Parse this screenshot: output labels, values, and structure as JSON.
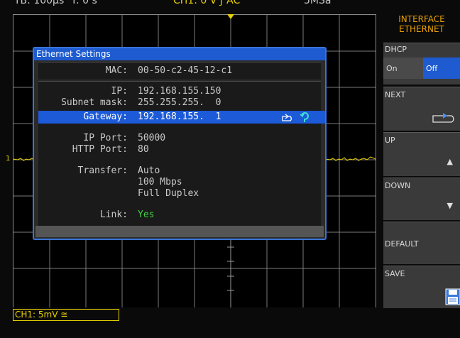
{
  "status_bar": {
    "timebase": "TB: 100µs",
    "offset": "T: 0 s",
    "trigger": "CH1: 0 V ƒ AC",
    "sample_rate": "5MSa"
  },
  "menu": {
    "title_line1": "INTERFACE",
    "title_line2": "ETHERNET",
    "dhcp_label": "DHCP",
    "dhcp_on": "On",
    "dhcp_off": "Off",
    "dhcp_selected": "Off",
    "next_label": "NEXT",
    "up_label": "UP",
    "down_label": "DOWN",
    "default_label": "DEFAULT",
    "save_label": "SAVE"
  },
  "dialog": {
    "title": "Ethernet Settings",
    "mac_label": "MAC:",
    "mac_value": "00-50-c2-45-12-c1",
    "ip_label": "IP:",
    "ip_value": "192.168.155.150",
    "subnet_label": "Subnet mask:",
    "subnet_value": "255.255.255.  0",
    "gateway_label": "Gateway:",
    "gateway_value": "192.168.155.  1",
    "ip_port_label": "IP Port:",
    "ip_port_value": "50000",
    "http_port_label": "HTTP Port:",
    "http_port_value": "80",
    "transfer_label": "Transfer:",
    "transfer_value_1": "Auto",
    "transfer_value_2": "100 Mbps",
    "transfer_value_3": "Full Duplex",
    "link_label": "Link:",
    "link_value": "Yes"
  },
  "channel": {
    "label": "CH1: 5mV ≅"
  },
  "colors": {
    "trace": "#e8d000",
    "dialog_blue": "#1e5bd0",
    "selected_green": "#40d040",
    "menu_title": "#e8a000"
  }
}
